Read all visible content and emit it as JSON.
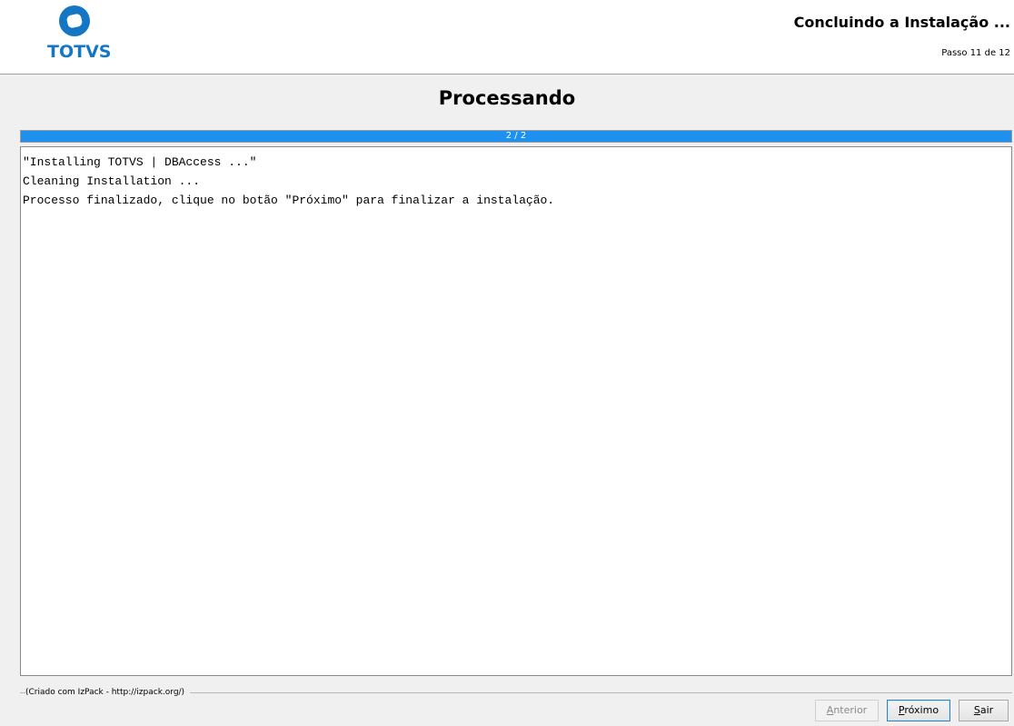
{
  "header": {
    "logo_text": "TOTVS",
    "step_title": "Concluindo a Instalação ...",
    "step_counter": "Passo 11 de 12"
  },
  "panel": {
    "heading": "Processando",
    "progress": {
      "label": "2 / 2",
      "fraction": 1.0,
      "fill_color": "#1e90f0"
    },
    "log_lines": [
      "\"Installing TOTVS | DBAccess ...\"",
      "Cleaning Installation ...",
      "Processo finalizado, clique no botão \"Próximo\" para finalizar a instalação."
    ]
  },
  "footer": {
    "credits": "(Criado com IzPack - http://izpack.org/)",
    "buttons": {
      "previous": {
        "mnemonic": "A",
        "rest": "nterior",
        "enabled": false
      },
      "next": {
        "mnemonic": "P",
        "rest": "róximo",
        "enabled": true
      },
      "quit": {
        "mnemonic": "S",
        "rest": "air",
        "enabled": true
      }
    }
  },
  "colors": {
    "brand_blue": "#1577c4",
    "progress_blue": "#1e90f0"
  },
  "icons": {
    "logo": "totvs-logo-icon"
  }
}
